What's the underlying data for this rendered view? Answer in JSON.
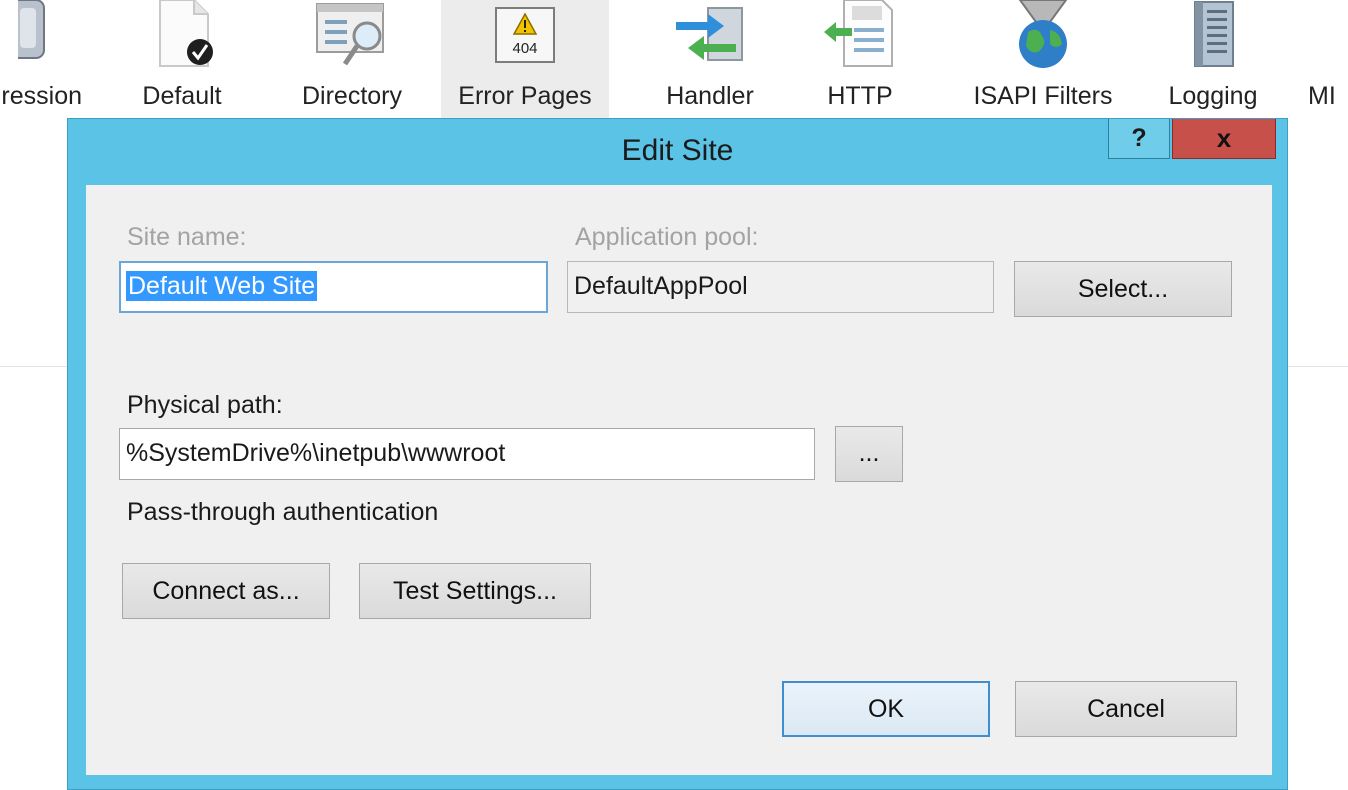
{
  "features": [
    {
      "label": "ression",
      "icon": "compression-icon"
    },
    {
      "label": "Default",
      "icon": "default-document-icon"
    },
    {
      "label": "Directory",
      "icon": "directory-browsing-icon"
    },
    {
      "label": "Error Pages",
      "icon": "error-pages-icon",
      "icon_text": "404",
      "selected": true
    },
    {
      "label": "Handler",
      "icon": "handler-mappings-icon"
    },
    {
      "label": "HTTP",
      "icon": "http-headers-icon"
    },
    {
      "label": "ISAPI Filters",
      "icon": "isapi-filters-icon"
    },
    {
      "label": "Logging",
      "icon": "logging-icon"
    },
    {
      "label": "MI",
      "icon": "mime-types-icon"
    }
  ],
  "dialog": {
    "title": "Edit Site",
    "help_label": "?",
    "close_label": "x",
    "site_name_label": "Site name:",
    "site_name_value": "Default Web Site",
    "app_pool_label": "Application pool:",
    "app_pool_value": "DefaultAppPool",
    "select_button": "Select...",
    "physical_path_label": "Physical path:",
    "physical_path_value": "%SystemDrive%\\inetpub\\wwwroot",
    "browse_button": "...",
    "passthrough_label": "Pass-through authentication",
    "connect_as_button": "Connect as...",
    "test_settings_button": "Test Settings...",
    "ok_button": "OK",
    "cancel_button": "Cancel"
  },
  "colors": {
    "title_bar": "#5bc3e6",
    "close_button": "#c7504a",
    "selection": "#3399ff",
    "client_area": "#f0f0f0"
  }
}
